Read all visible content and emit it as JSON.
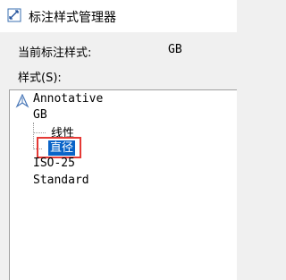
{
  "window": {
    "title": "标注样式管理器",
    "icon": "dimension-style-icon"
  },
  "current_style": {
    "label": "当前标注样式:",
    "value": "GB"
  },
  "styles": {
    "label": "样式(S):",
    "items": [
      {
        "label": "Annotative",
        "icon": "annotative-icon"
      },
      {
        "label": "GB"
      },
      {
        "label": "线性"
      },
      {
        "label": "直径",
        "selected": true
      },
      {
        "label": "ISO-25"
      },
      {
        "label": "Standard"
      }
    ]
  },
  "colors": {
    "selection": "#0a64c8",
    "highlight_box": "#e53935"
  }
}
